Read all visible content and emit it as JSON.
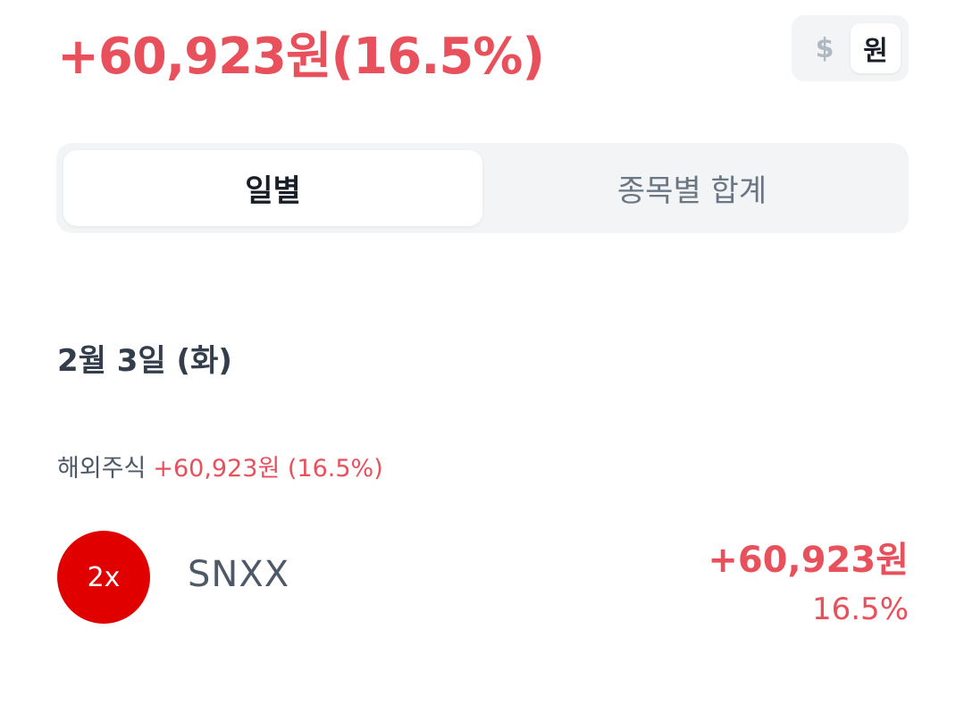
{
  "summary": {
    "total_profit": "+60,923원(16.5%)"
  },
  "currency_toggle": {
    "usd_label": "$",
    "krw_label": "원",
    "selected": "원"
  },
  "tabs": {
    "items": [
      {
        "label": "일별"
      },
      {
        "label": "종목별 합계"
      }
    ],
    "selected": "일별"
  },
  "daily": {
    "date": "2월 3일 (화)",
    "category": {
      "label": "해외주식",
      "value": "+60,923원 (16.5%)"
    },
    "stocks": [
      {
        "logo_text": "2x",
        "name": "SNXX",
        "amount": "+60,923원",
        "rate": "16.5%"
      }
    ]
  },
  "colors": {
    "profit": "#e8505b",
    "logo_bg": "#e00000",
    "segment_bg": "#f2f4f6"
  }
}
